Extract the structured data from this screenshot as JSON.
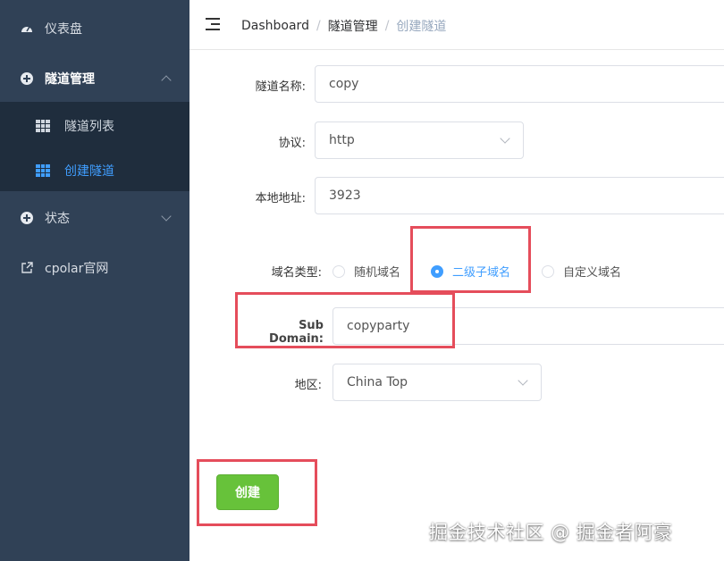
{
  "sidebar": {
    "dashboard": {
      "label": "仪表盘",
      "icon": "gauge-icon"
    },
    "tunnel_mgmt": {
      "label": "隧道管理",
      "icon": "plus-circle-icon"
    },
    "tunnel_list": {
      "label": "隧道列表",
      "icon": "grid-icon"
    },
    "create_tunnel": {
      "label": "创建隧道",
      "icon": "grid-icon"
    },
    "status": {
      "label": "状态",
      "icon": "plus-circle-icon"
    },
    "cpolar_site": {
      "label": "cpolar官网",
      "icon": "external-link-icon"
    }
  },
  "header": {
    "breadcrumb": [
      "Dashboard",
      "隧道管理",
      "创建隧道"
    ],
    "separator": "/"
  },
  "form": {
    "name": {
      "label": "隧道名称:",
      "value": "copy"
    },
    "protocol": {
      "label": "协议:",
      "value": "http"
    },
    "local_addr": {
      "label": "本地地址:",
      "value": "3923"
    },
    "domain_type": {
      "label": "域名类型:",
      "options": [
        "随机域名",
        "二级子域名",
        "自定义域名"
      ],
      "selected": "二级子域名"
    },
    "sub_domain": {
      "label": "Sub Domain:",
      "value": "copyparty"
    },
    "region": {
      "label": "地区:",
      "value": "China Top"
    },
    "submit_label": "创建"
  },
  "watermark": "掘金技术社区 @ 掘金者阿豪",
  "colors": {
    "sidebar_bg": "#304156",
    "submenu_bg": "#1f2d3d",
    "active": "#409eff",
    "button": "#67c23a",
    "highlight": "#e54d5b"
  }
}
